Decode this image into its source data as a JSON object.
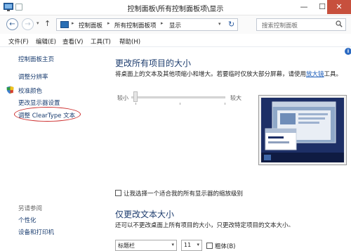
{
  "window": {
    "title": "控制面板\\所有控制面板项\\显示",
    "minimize_glyph": "—",
    "maximize_glyph": "☐",
    "close_glyph": "✕"
  },
  "address": {
    "back_glyph": "←",
    "forward_glyph": "→",
    "dropdown_glyph": "▾",
    "up_glyph": "↑",
    "crumbs": [
      "控制面板",
      "所有控制面板项",
      "显示"
    ],
    "separator": "▸",
    "refresh_glyph": "↻",
    "search_placeholder": "搜索控制面板"
  },
  "menu": {
    "items": [
      "文件(F)",
      "编辑(E)",
      "查看(V)",
      "工具(T)",
      "帮助(H)"
    ]
  },
  "sidebar": {
    "links": [
      "控制面板主页",
      "调整分辨率",
      "校准颜色",
      "更改显示器设置",
      "调整 ClearType 文本"
    ],
    "see_also": "另请参阅",
    "see_also_links": [
      "个性化",
      "设备和打印机"
    ]
  },
  "main": {
    "info_glyph": "i",
    "heading": "更改所有项目的大小",
    "description": "将桌面上的文本及其他项缩小和增大。若要临时仅放大部分屏幕，请使用",
    "magnifier_link": "放大镜",
    "description_end": "工具。",
    "slider_small": "较小",
    "slider_large": "较大",
    "slider_level": 0,
    "checkbox_label": "让我选择一个适合我的所有显示器的缩放级别",
    "heading2": "仅更改文本大小",
    "description2": "还可以不更改桌面上所有项目的大小，只更改特定项目的文本大小。",
    "selects": [
      "标题栏",
      "11",
      ""
    ],
    "bold_label": "粗体(B)"
  },
  "colors": {
    "accent": "#1d3c6e",
    "link": "#1a3d70",
    "close": "#c7503d",
    "highlight": "#cc2b2b",
    "preview_bg": "#1d2f66"
  }
}
